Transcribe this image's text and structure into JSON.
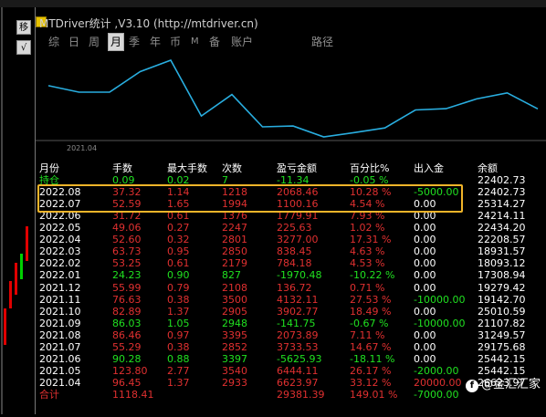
{
  "window": {
    "title": "MTDriver统计 ,V3.10 (http://mtdriver.cn)"
  },
  "left_tools": [
    "移",
    "√"
  ],
  "tabs": [
    {
      "label": "综",
      "selected": false
    },
    {
      "label": "日",
      "selected": false
    },
    {
      "label": "周",
      "selected": false
    },
    {
      "label": "月",
      "selected": true
    },
    {
      "label": "季",
      "selected": false
    },
    {
      "label": "年",
      "selected": false
    },
    {
      "label": "币",
      "selected": false
    },
    {
      "label": "M",
      "selected": false
    },
    {
      "label": "备",
      "selected": false
    },
    {
      "label": "账户",
      "selected": false
    },
    {
      "label": "路径",
      "selected": false
    }
  ],
  "chart_data": {
    "type": "line",
    "x_tick_label": "2021.04",
    "x": [
      "2021.04",
      "2021.05",
      "2021.06",
      "2021.07",
      "2021.08",
      "2021.09",
      "2021.10",
      "2021.11",
      "2021.12",
      "2022.01",
      "2022.02",
      "2022.03",
      "2022.04",
      "2022.05",
      "2022.06",
      "2022.07",
      "2022.08"
    ],
    "series": [
      {
        "values": [
          26623.97,
          25442.15,
          25441.28,
          29175.68,
          31249.57,
          21107.82,
          25010.59,
          19142.7,
          19279.42,
          17308.94,
          18093.12,
          18931.57,
          22208.57,
          22434.2,
          24214.11,
          25314.27,
          22402.73
        ],
        "color": "#29aee0"
      }
    ]
  },
  "table": {
    "headers": [
      "月份",
      "手数",
      "最大手数",
      "次数",
      "盈亏金额",
      "百分比%",
      "出入金",
      "余额"
    ],
    "highlight_rows": [
      1,
      2
    ],
    "rows": [
      {
        "month": "持仓",
        "lots": "0.09",
        "max_lots": "0.02",
        "count": "7",
        "pl": "-11.34",
        "pct": "-0.05 %",
        "io": "",
        "balance": "22402.73",
        "color": "green",
        "io_color": "",
        "month_color": "green"
      },
      {
        "month": "2022.08",
        "lots": "37.32",
        "max_lots": "1.14",
        "count": "1218",
        "pl": "2068.46",
        "pct": "10.28 %",
        "io": "-5000.00",
        "balance": "22402.73",
        "color": "red",
        "io_color": "green",
        "month_color": ""
      },
      {
        "month": "2022.07",
        "lots": "52.59",
        "max_lots": "1.65",
        "count": "1994",
        "pl": "1100.16",
        "pct": "4.54 %",
        "io": "0.00",
        "balance": "25314.27",
        "color": "red",
        "io_color": "",
        "month_color": ""
      },
      {
        "month": "2022.06",
        "lots": "31.72",
        "max_lots": "0.61",
        "count": "1376",
        "pl": "1779.91",
        "pct": "7.93 %",
        "io": "0.00",
        "balance": "24214.11",
        "color": "red",
        "io_color": "",
        "month_color": ""
      },
      {
        "month": "2022.05",
        "lots": "49.06",
        "max_lots": "0.27",
        "count": "2247",
        "pl": "225.63",
        "pct": "1.02 %",
        "io": "0.00",
        "balance": "22434.20",
        "color": "red",
        "io_color": "",
        "month_color": ""
      },
      {
        "month": "2022.04",
        "lots": "52.60",
        "max_lots": "0.32",
        "count": "2801",
        "pl": "3277.00",
        "pct": "17.31 %",
        "io": "0.00",
        "balance": "22208.57",
        "color": "red",
        "io_color": "",
        "month_color": ""
      },
      {
        "month": "2022.03",
        "lots": "63.73",
        "max_lots": "0.95",
        "count": "2850",
        "pl": "838.45",
        "pct": "4.63 %",
        "io": "0.00",
        "balance": "18931.57",
        "color": "red",
        "io_color": "",
        "month_color": ""
      },
      {
        "month": "2022.02",
        "lots": "53.25",
        "max_lots": "0.61",
        "count": "2179",
        "pl": "784.18",
        "pct": "4.53 %",
        "io": "0.00",
        "balance": "18093.12",
        "color": "red",
        "io_color": "",
        "month_color": ""
      },
      {
        "month": "2022.01",
        "lots": "24.23",
        "max_lots": "0.90",
        "count": "827",
        "pl": "-1970.48",
        "pct": "-10.22 %",
        "io": "0.00",
        "balance": "17308.94",
        "color": "green",
        "io_color": "",
        "month_color": ""
      },
      {
        "month": "2021.12",
        "lots": "55.99",
        "max_lots": "0.79",
        "count": "2108",
        "pl": "136.72",
        "pct": "0.71 %",
        "io": "0.00",
        "balance": "19279.42",
        "color": "red",
        "io_color": "",
        "month_color": ""
      },
      {
        "month": "2021.11",
        "lots": "76.63",
        "max_lots": "0.38",
        "count": "3500",
        "pl": "4132.11",
        "pct": "27.53 %",
        "io": "-10000.00",
        "balance": "19142.70",
        "color": "red",
        "io_color": "green",
        "month_color": ""
      },
      {
        "month": "2021.10",
        "lots": "82.89",
        "max_lots": "1.37",
        "count": "2905",
        "pl": "3902.77",
        "pct": "18.49 %",
        "io": "0.00",
        "balance": "25010.59",
        "color": "red",
        "io_color": "",
        "month_color": ""
      },
      {
        "month": "2021.09",
        "lots": "86.03",
        "max_lots": "1.05",
        "count": "2948",
        "pl": "-141.75",
        "pct": "-0.67 %",
        "io": "-10000.00",
        "balance": "21107.82",
        "color": "green",
        "io_color": "green",
        "month_color": ""
      },
      {
        "month": "2021.08",
        "lots": "86.46",
        "max_lots": "0.97",
        "count": "3395",
        "pl": "2073.89",
        "pct": "7.11 %",
        "io": "0.00",
        "balance": "31249.57",
        "color": "red",
        "io_color": "",
        "month_color": ""
      },
      {
        "month": "2021.07",
        "lots": "55.29",
        "max_lots": "0.38",
        "count": "2852",
        "pl": "3733.53",
        "pct": "14.67 %",
        "io": "0.00",
        "balance": "29175.68",
        "color": "red",
        "io_color": "",
        "month_color": ""
      },
      {
        "month": "2021.06",
        "lots": "90.28",
        "max_lots": "0.88",
        "count": "3397",
        "pl": "-5625.93",
        "pct": "-18.11 %",
        "io": "0.00",
        "balance": "25442.15",
        "color": "green",
        "io_color": "",
        "month_color": ""
      },
      {
        "month": "2021.05",
        "lots": "123.80",
        "max_lots": "2.77",
        "count": "3540",
        "pl": "6444.11",
        "pct": "26.17 %",
        "io": "-2000.00",
        "balance": "25442.15",
        "color": "red",
        "io_color": "green",
        "month_color": ""
      },
      {
        "month": "2021.04",
        "lots": "96.45",
        "max_lots": "1.37",
        "count": "2933",
        "pl": "6623.97",
        "pct": "33.12 %",
        "io": "20000.00",
        "balance": "26623.97",
        "color": "red",
        "io_color": "red",
        "month_color": ""
      }
    ],
    "total": {
      "month": "合计",
      "lots": "1118.41",
      "max_lots": "",
      "count": "",
      "pl": "29381.39",
      "pct": "149.01 %",
      "io": "-7000.00",
      "balance": "",
      "color": "red",
      "io_color": "green"
    }
  },
  "watermark": {
    "badge": "f",
    "text": "@金汇汇家"
  }
}
